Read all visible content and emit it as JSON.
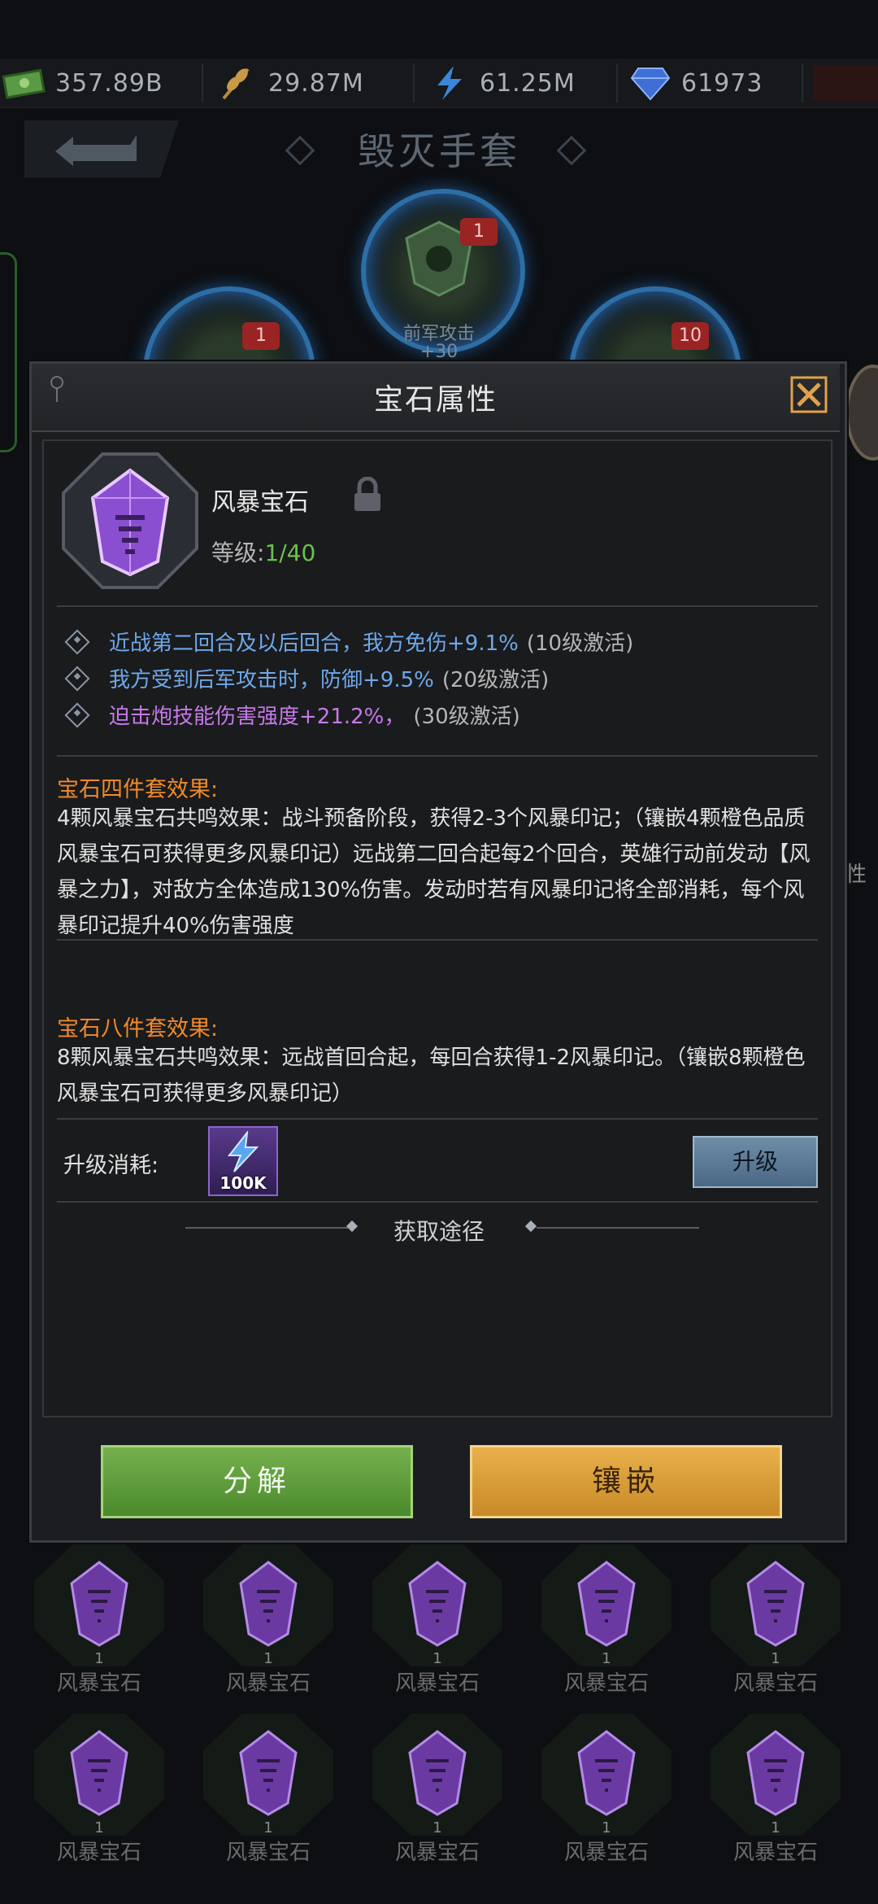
{
  "resources": [
    {
      "icon": "cash-icon",
      "value": "357.89B"
    },
    {
      "icon": "wheat-icon",
      "value": "29.87M"
    },
    {
      "icon": "lightning-icon",
      "value": "61.25M"
    },
    {
      "icon": "diamond-icon",
      "value": "61973"
    }
  ],
  "header": {
    "title": "毁灭手套"
  },
  "background_slots": {
    "center_badge": "1",
    "left_badge": "1",
    "right_badge": "10",
    "center_label": "前军攻击",
    "center_value": "+30",
    "side_right_text": "性"
  },
  "modal": {
    "title": "宝石属性",
    "gem": {
      "name": "风暴宝石",
      "level_label": "等级:",
      "level_value": "1/40"
    },
    "effects": [
      {
        "text": "近战第二回合及以后回合，我方免伤+9.1%",
        "note": "(10级激活)",
        "color": "blue"
      },
      {
        "text": "我方受到后军攻击时，防御+9.5%",
        "note": "(20级激活)",
        "color": "blue"
      },
      {
        "text": "迫击炮技能伤害强度+21.2%，",
        "note": "(30级激活)",
        "color": "purple"
      }
    ],
    "set4": {
      "title": "宝石四件套效果:",
      "body": "4颗风暴宝石共鸣效果：战斗预备阶段，获得2-3个风暴印记；（镶嵌4颗橙色品质风暴宝石可获得更多风暴印记）远战第二回合起每2个回合，英雄行动前发动【风暴之力】，对敌方全体造成130%伤害。发动时若有风暴印记将全部消耗，每个风暴印记提升40%伤害强度"
    },
    "set8": {
      "title": "宝石八件套效果:",
      "body": "8颗风暴宝石共鸣效果：远战首回合起，每回合获得1-2风暴印记。（镶嵌8颗橙色风暴宝石可获得更多风暴印记）"
    },
    "upgrade": {
      "label": "升级消耗:",
      "cost": "100K",
      "button": "升级"
    },
    "obtain_title": "获取途径",
    "decompose_button": "分解",
    "embed_button": "镶嵌"
  },
  "grid": {
    "item_name": "风暴宝石",
    "item_count": "1"
  },
  "colors": {
    "accent_green": "#6bc24a",
    "effect_blue": "#6ea8ea",
    "effect_purple": "#c47ae8",
    "set_orange": "#f08a2b"
  }
}
